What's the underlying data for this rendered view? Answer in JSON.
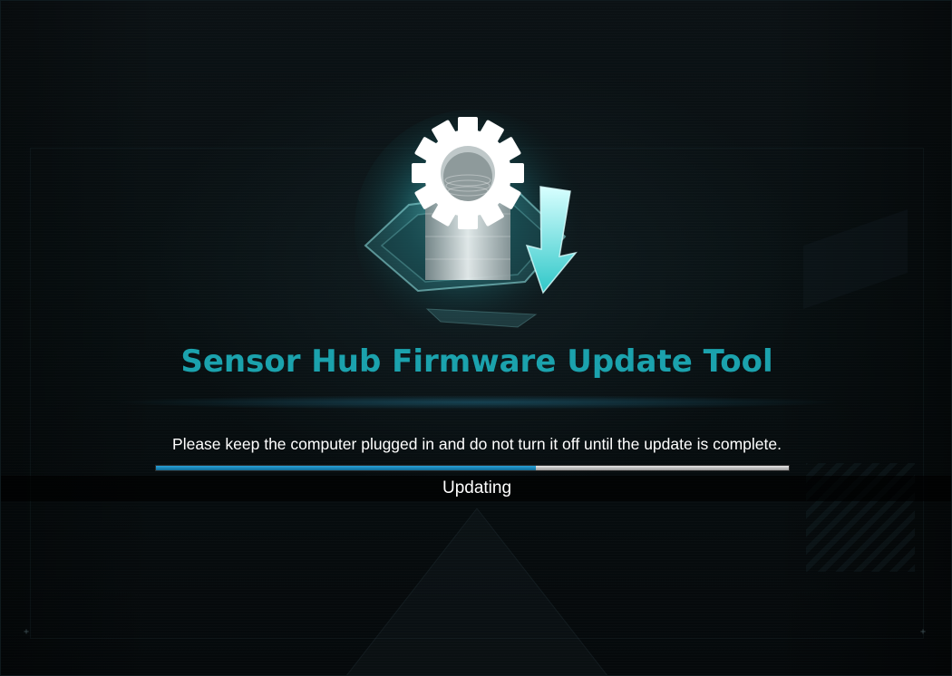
{
  "title": "Sensor Hub Firmware Update Tool",
  "message": "Please keep the computer plugged in and do not turn it off until the update is complete.",
  "progress": {
    "fraction": 0.6,
    "status": "Updating"
  },
  "colors": {
    "title": "#1ba2ad",
    "progress_fill": "#1a85bb",
    "progress_track": "#c8c8c8",
    "background": "#050708"
  },
  "icons": {
    "hero": "gear-download-icon"
  }
}
